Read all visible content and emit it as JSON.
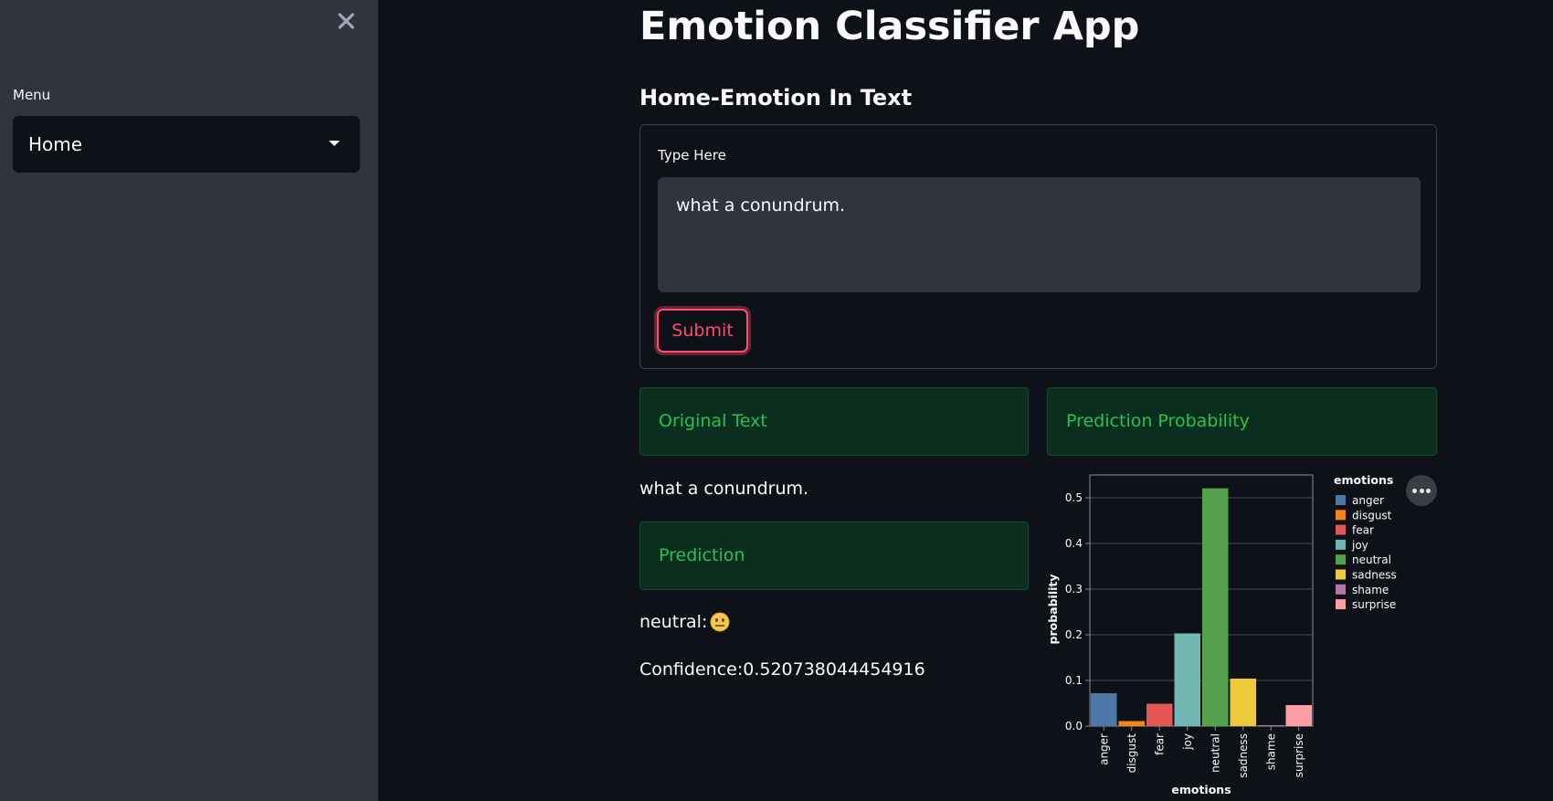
{
  "sidebar": {
    "menu_label": "Menu",
    "selected_option": "Home",
    "close_icon": "close-icon"
  },
  "main": {
    "title": "Emotion Classifier App",
    "subheader": "Home-Emotion In Text",
    "form": {
      "input_label": "Type Here",
      "input_value": "what a conundrum.",
      "submit_label": "Submit"
    },
    "original_text_header": "Original Text",
    "original_text": "what a conundrum.",
    "prediction_header": "Prediction",
    "prediction_label": "neutral:",
    "prediction_emoji": "neutral-face-emoji",
    "confidence_text": "Confidence:0.520738044454916",
    "probability_header": "Prediction Probability"
  },
  "chart_data": {
    "type": "bar",
    "categories": [
      "anger",
      "disgust",
      "fear",
      "joy",
      "neutral",
      "sadness",
      "shame",
      "surprise"
    ],
    "values": [
      0.072,
      0.011,
      0.049,
      0.203,
      0.5207,
      0.104,
      0.002,
      0.046
    ],
    "colors": [
      "#4c78a8",
      "#f58518",
      "#e45756",
      "#72b7b2",
      "#54a24b",
      "#eeca3b",
      "#b279a2",
      "#ff9da6"
    ],
    "xlabel": "emotions",
    "ylabel": "probability",
    "legend_title": "emotions",
    "legend_position": "right",
    "yticks": [
      "0.0",
      "0.1",
      "0.2",
      "0.3",
      "0.4",
      "0.5"
    ],
    "ylim": [
      0,
      0.55
    ],
    "grid": true
  }
}
